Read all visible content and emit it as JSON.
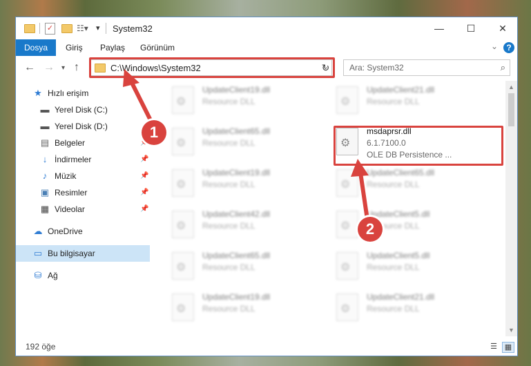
{
  "window": {
    "title": "System32",
    "controls": {
      "minimize": "—",
      "maximize": "☐",
      "close": "✕"
    }
  },
  "ribbon": {
    "tabs": [
      "Dosya",
      "Giriş",
      "Paylaş",
      "Görünüm"
    ],
    "help": "?"
  },
  "nav": {
    "address": "C:\\Windows\\System32",
    "search_placeholder": "Ara: System32"
  },
  "sidebar": {
    "items": [
      {
        "label": "Hızlı erişim",
        "icon": "star-icon",
        "pinned": false
      },
      {
        "label": "Yerel Disk (C:)",
        "icon": "disk-icon",
        "pinned": false
      },
      {
        "label": "Yerel Disk (D:)",
        "icon": "disk-icon",
        "pinned": false
      },
      {
        "label": "Belgeler",
        "icon": "documents-icon",
        "pinned": true
      },
      {
        "label": "İndirmeler",
        "icon": "download-icon",
        "pinned": true
      },
      {
        "label": "Müzik",
        "icon": "music-icon",
        "pinned": true
      },
      {
        "label": "Resimler",
        "icon": "pictures-icon",
        "pinned": true
      },
      {
        "label": "Videolar",
        "icon": "videos-icon",
        "pinned": true
      },
      {
        "label": "OneDrive",
        "icon": "cloud-icon",
        "pinned": false
      },
      {
        "label": "Bu bilgisayar",
        "icon": "computer-icon",
        "pinned": false,
        "selected": true
      },
      {
        "label": "Ağ",
        "icon": "network-icon",
        "pinned": false
      }
    ]
  },
  "files": {
    "left": [
      {
        "name": "UpdateClient19.dll",
        "type": "Resource DLL"
      },
      {
        "name": "UpdateClient65.dll",
        "type": "Resource DLL"
      },
      {
        "name": "UpdateClient19.dll",
        "type": "Resource DLL"
      },
      {
        "name": "UpdateClient42.dll",
        "type": "Resource DLL"
      },
      {
        "name": "UpdateClient65.dll",
        "type": "Resource DLL"
      },
      {
        "name": "UpdateClient19.dll",
        "type": "Resource DLL"
      }
    ],
    "right": [
      {
        "name": "UpdateClient21.dll",
        "type": "Resource DLL"
      },
      {
        "name": "msdaprsr.dll",
        "version": "6.1.7100.0",
        "type": "OLE DB Persistence ...",
        "highlighted": true
      },
      {
        "name": "UpdateClient65.dll",
        "type": "Resource DLL"
      },
      {
        "name": "UpdateClient5.dll",
        "type": "Resource DLL"
      },
      {
        "name": "UpdateClient5.dll",
        "type": "Resource DLL"
      },
      {
        "name": "UpdateClient21.dll",
        "type": "Resource DLL"
      }
    ]
  },
  "status": {
    "count": "192 öğe"
  },
  "annotations": {
    "marker1": "1",
    "marker2": "2",
    "color": "#d9433e"
  },
  "colors": {
    "accent": "#1979ca",
    "selection": "#cce4f7",
    "highlight": "#d9433e"
  }
}
